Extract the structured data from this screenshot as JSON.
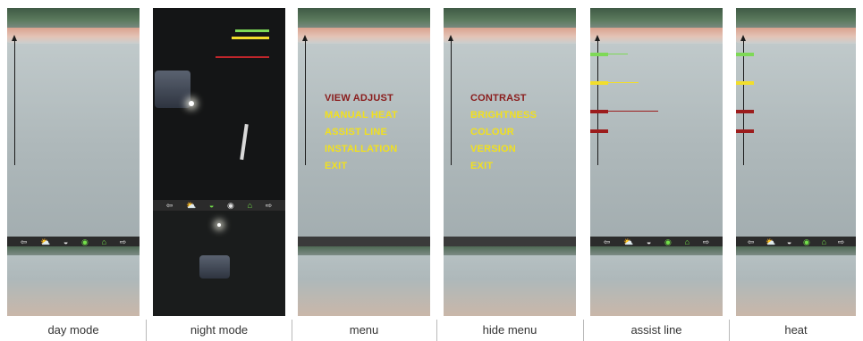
{
  "captions": [
    "day mode",
    "night mode",
    "menu",
    "hide menu",
    "assist line",
    "heat"
  ],
  "toolbar_icons": [
    {
      "name": "left-arrow-icon",
      "glyph": "⇦",
      "active": false
    },
    {
      "name": "day-icon",
      "glyph": "⛅",
      "active": false
    },
    {
      "name": "night-icon",
      "glyph": "◒",
      "active": false
    },
    {
      "name": "eye-icon",
      "glyph": "◉",
      "active": true
    },
    {
      "name": "heat-icon",
      "glyph": "⌂",
      "active": true
    },
    {
      "name": "right-arrow-icon",
      "glyph": "⇨",
      "active": false
    }
  ],
  "menu": {
    "items": [
      "VIEW ADJUST",
      "MANUAL HEAT",
      "ASSIST LINE",
      "INSTALLATION",
      "EXIT"
    ],
    "selected_index": 0
  },
  "hide_menu": {
    "items": [
      "CONTRAST",
      "BRIGHTNESS",
      "COLOUR",
      "VERSION",
      "EXIT"
    ],
    "selected_index": 0
  },
  "colors": {
    "menu_text": "#f1e01f",
    "menu_selected": "#8a1c1c",
    "assist_green": "#7ed957",
    "assist_yellow": "#f2de2b",
    "assist_red": "#9c1c1c",
    "toolbar_bg": "#2b2b2b",
    "toolbar_active": "#73e04a"
  }
}
